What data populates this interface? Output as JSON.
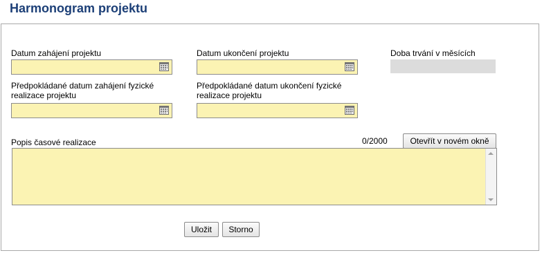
{
  "title": "Harmonogram projektu",
  "fields": {
    "start_label": "Datum zahájení projektu",
    "start_value": "",
    "end_label": "Datum ukončení projektu",
    "end_value": "",
    "duration_label": "Doba trvání v měsících",
    "duration_value": "",
    "phys_start_label_line1": "Předpokládané datum zahájení fyzické",
    "phys_start_label_line2": "realizace projektu",
    "phys_start_value": "",
    "phys_end_label_line1": "Předpokládané datum ukončení fyzické",
    "phys_end_label_line2": "realizace projektu",
    "phys_end_value": ""
  },
  "description": {
    "label": "Popis časové realizace",
    "counter": "0/2000",
    "open_window_label": "Otevřít v novém okně",
    "value": ""
  },
  "actions": {
    "save_label": "Uložit",
    "cancel_label": "Storno"
  },
  "colors": {
    "title": "#1c3f77",
    "field_background": "#fbf3b3",
    "readonly_background": "#dcdcdc"
  },
  "icons": {
    "calendar": "calendar-icon"
  }
}
